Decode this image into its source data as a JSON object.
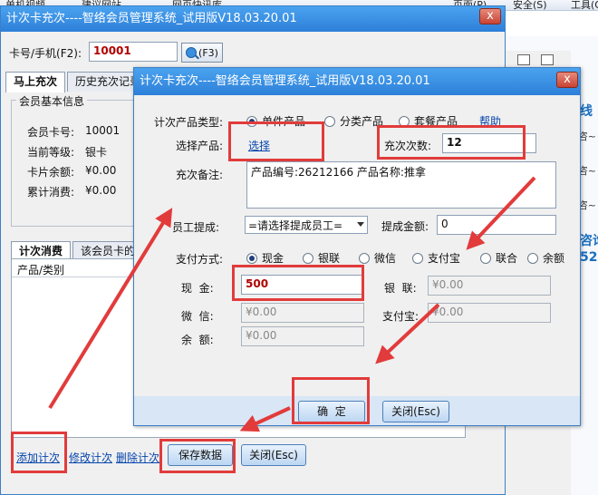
{
  "browser": {
    "items": [
      "单机视频",
      "建议网站",
      "网页快讯库",
      "页面(P)",
      "安全(S)",
      "工具(O)"
    ],
    "right_texts": [
      "线",
      "咨~",
      "咨~",
      "咨~",
      "咨询",
      "52"
    ]
  },
  "back_window": {
    "title": "计次卡充次----智络会员管理系统_试用版V18.03.20.01",
    "close_label": "x",
    "card_label": "卡号/手机(F2):",
    "card_value": "10001",
    "search_label": "(F3)",
    "tabs": [
      "马上充次",
      "历史充次记录"
    ],
    "member_group": {
      "title": "会员基本信息",
      "rows": [
        {
          "label": "会员卡号:",
          "value": "10001"
        },
        {
          "label": "当前等级:",
          "value": "银卡"
        },
        {
          "label": "卡片余额:",
          "value": "¥0.00"
        },
        {
          "label": "累计消费:",
          "value": "¥0.00"
        }
      ]
    },
    "lower_tabs": [
      "计次消费",
      "该会员卡的"
    ],
    "list_header": "产品/类别",
    "links": [
      "添加计次",
      "修改计次",
      "删除计次"
    ],
    "save_label": "保存数据",
    "close_button_label": "关闭(Esc)"
  },
  "dialog": {
    "title": "计次卡充次----智络会员管理系统_试用版V18.03.20.01",
    "close_label": "x",
    "product_type_label": "计次产品类型:",
    "product_types": [
      "单件产品",
      "分类产品",
      "套餐产品"
    ],
    "help_label": "帮助",
    "select_product_label": "选择产品:",
    "select_link": "选择",
    "recharge_count_label": "充次次数:",
    "recharge_count_value": "12",
    "remark_label": "充次备注:",
    "remark_value": "产品编号:26212166 产品名称:推拿",
    "staff_label": "员工提成:",
    "staff_select": "=请选择提成员工=",
    "commission_label": "提成金额:",
    "commission_value": "0",
    "pay_label": "支付方式:",
    "pay_methods": [
      "现金",
      "银联",
      "微信",
      "支付宝",
      "联合",
      "余额"
    ],
    "cash_label": "现  金:",
    "cash_value": "500",
    "unionpay_label": "银  联:",
    "unionpay_value": "¥0.00",
    "wechat_label": "微  信:",
    "wechat_value": "¥0.00",
    "alipay_label": "支付宝:",
    "alipay_value": "¥0.00",
    "balance_label": "余  额:",
    "balance_value": "¥0.00",
    "ok_label": "确  定",
    "close_button_label": "关闭(Esc)"
  },
  "colors": {
    "titlebar": "#2d7fd8",
    "annotation": "#e23b3b",
    "card_value": "#b00000"
  }
}
